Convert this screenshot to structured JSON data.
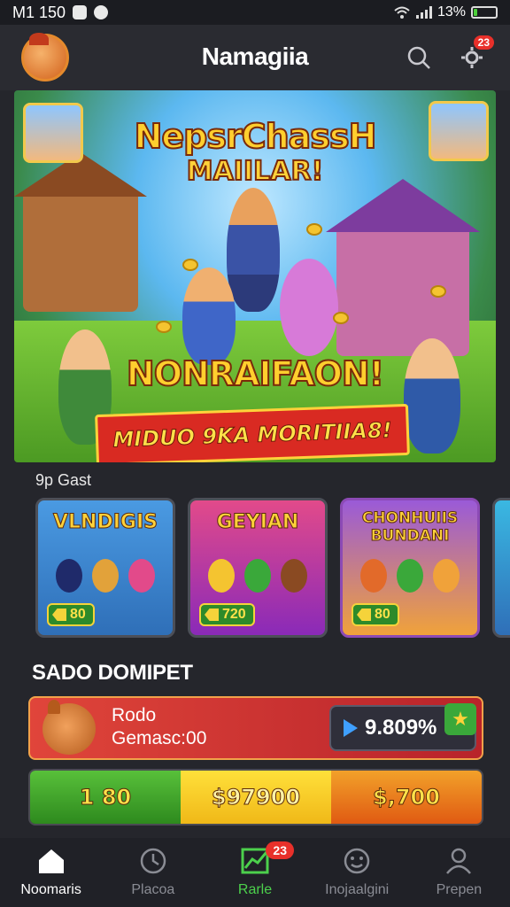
{
  "status_bar": {
    "time": "M1 150",
    "battery": "13%",
    "battery_level": 0.13
  },
  "header": {
    "title": "Namagiia",
    "notification_count": "23"
  },
  "hero": {
    "title": "NepsrChassH",
    "subtitle": "MAIILAR!",
    "headline": "NONRAIFAON!",
    "ribbon": "MIDUO 9KA MORITIIA8!"
  },
  "section": {
    "label": "9p Gast"
  },
  "games": [
    {
      "title": "VLNDIGIS",
      "price": "80",
      "art_colors": [
        "#1f2a6a",
        "#e2a23a",
        "#e24a8a"
      ]
    },
    {
      "title": "GEYIAN",
      "price": "720",
      "art_colors": [
        "#f4c430",
        "#3aa83a",
        "#8a4a22"
      ]
    },
    {
      "title": "CHONHUIIS BUNDANI",
      "price": "80",
      "art_colors": [
        "#e26a2a",
        "#3aa83a",
        "#f0a23a"
      ]
    },
    {
      "title": "",
      "price": ""
    }
  ],
  "wallet": {
    "heading": "SADO DOMIPET",
    "name": "Rodo",
    "subtitle": "Gemasc:00",
    "value": "9.809%",
    "balances": [
      "1 80",
      "$97900",
      "$,700"
    ]
  },
  "bottom_nav": [
    {
      "label": "Noomaris",
      "icon": "home-icon"
    },
    {
      "label": "Placoa",
      "icon": "clock-icon"
    },
    {
      "label": "Rarle",
      "icon": "chart-icon",
      "badge": "23"
    },
    {
      "label": "Inojaalgini",
      "icon": "smile-icon"
    },
    {
      "label": "Prepen",
      "icon": "user-icon"
    }
  ]
}
